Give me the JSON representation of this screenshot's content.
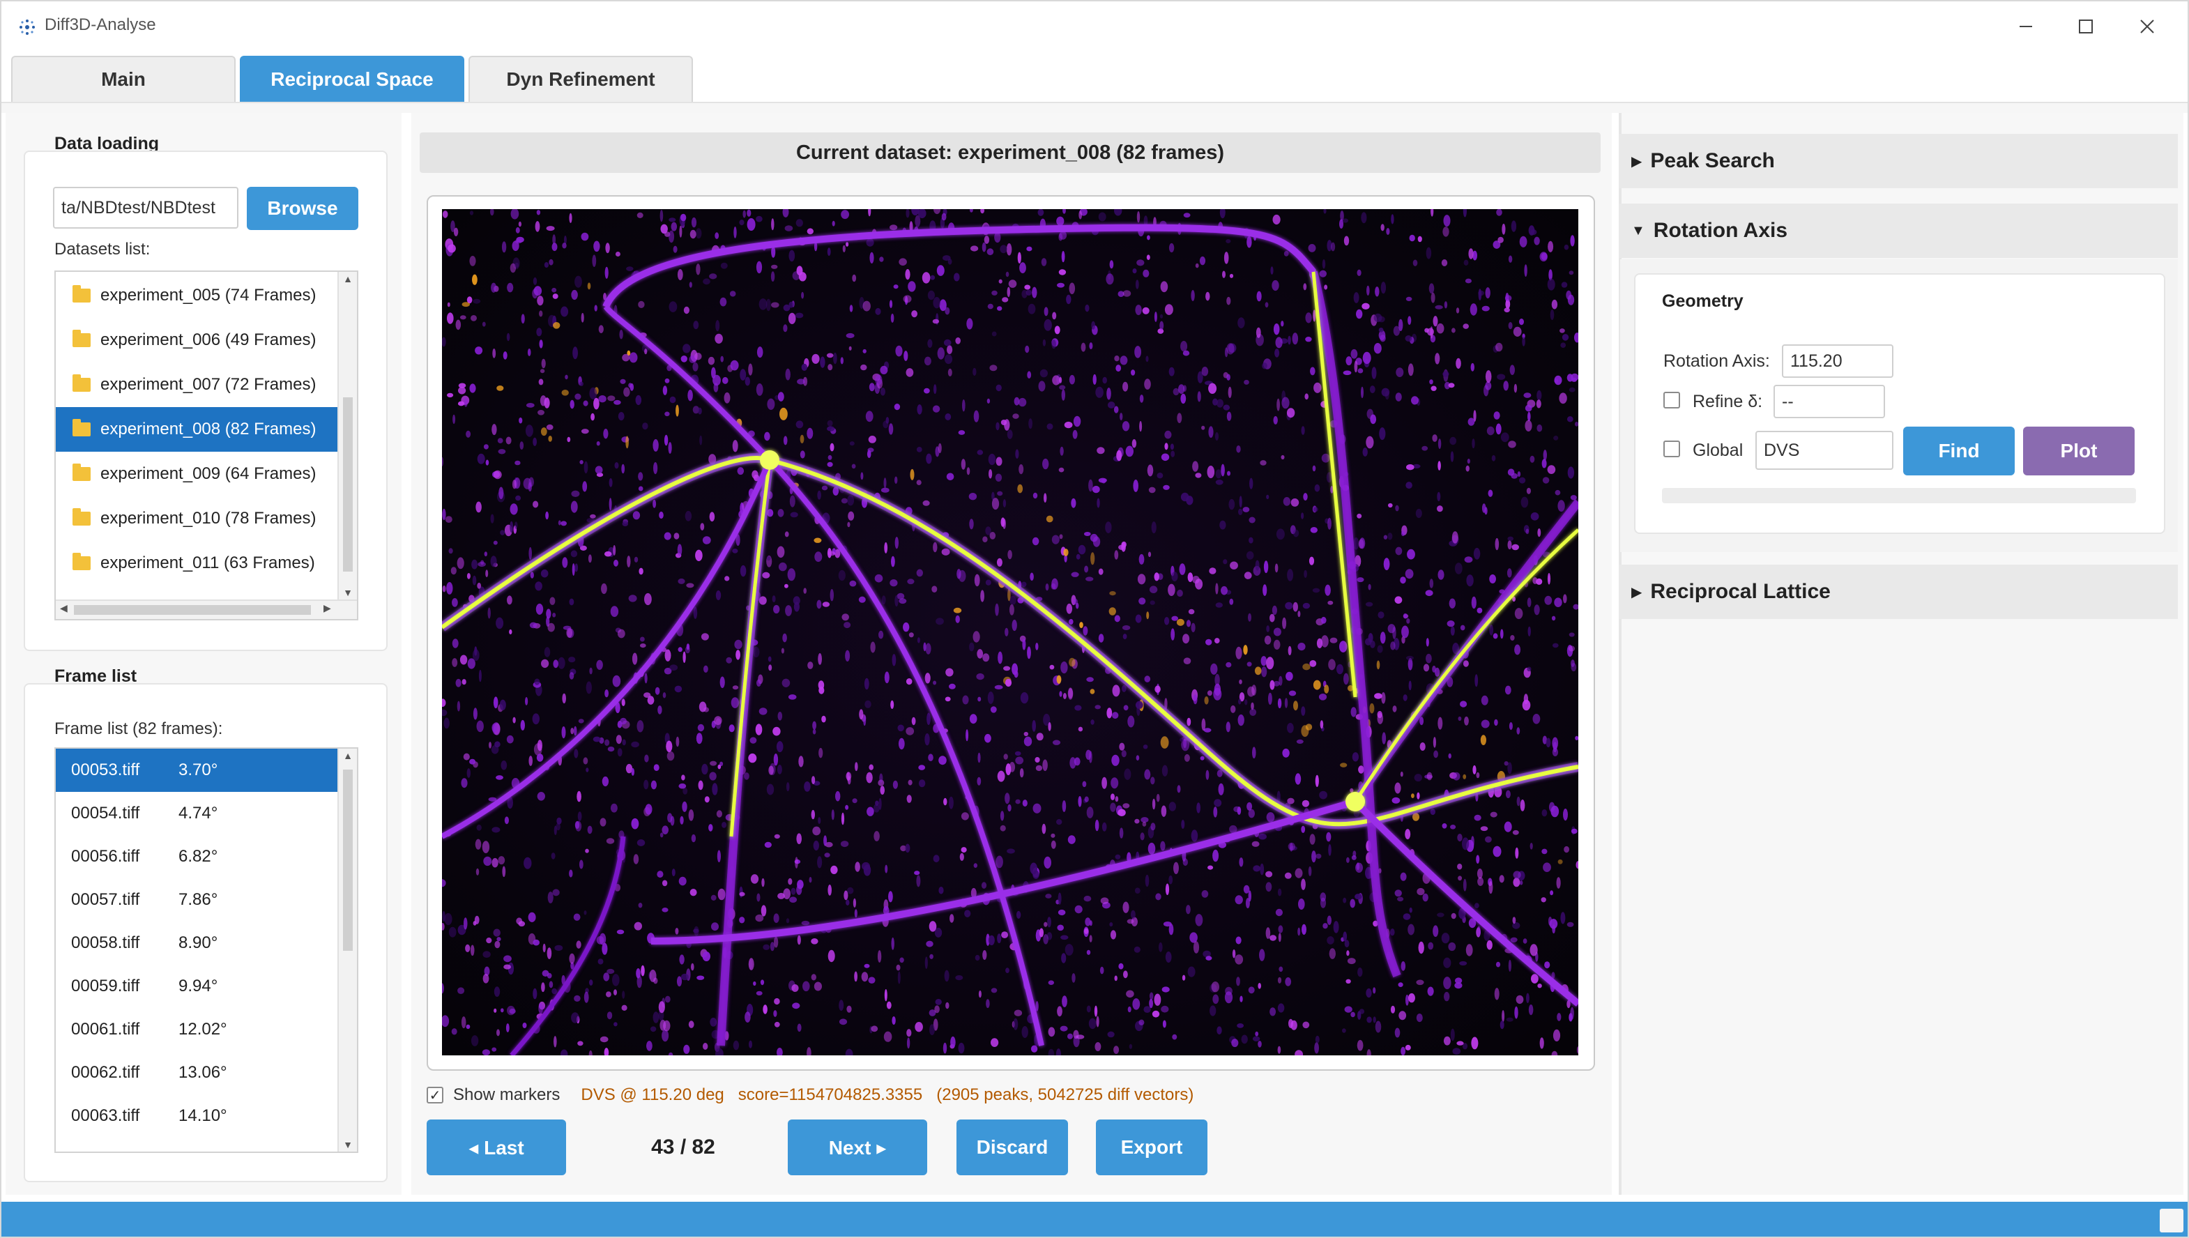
{
  "window": {
    "title": "Diff3D-Analyse",
    "icon": "app-logo-icon",
    "controls": [
      "minimize-icon",
      "maximize-icon",
      "close-icon"
    ]
  },
  "tabs": [
    {
      "label": "Main",
      "active": false
    },
    {
      "label": "Reciprocal Space",
      "active": true
    },
    {
      "label": "Dyn Refinement",
      "active": false
    }
  ],
  "left": {
    "data_loading": {
      "title": "Data loading",
      "path_value": "ta/NBDtest/NBDtest",
      "browse_label": "Browse",
      "datasets_label": "Datasets list:",
      "datasets": [
        {
          "label": "experiment_005 (74 Frames)",
          "selected": false
        },
        {
          "label": "experiment_006 (49 Frames)",
          "selected": false
        },
        {
          "label": "experiment_007 (72 Frames)",
          "selected": false
        },
        {
          "label": "experiment_008 (82 Frames)",
          "selected": true
        },
        {
          "label": "experiment_009 (64 Frames)",
          "selected": false
        },
        {
          "label": "experiment_010 (78 Frames)",
          "selected": false
        },
        {
          "label": "experiment_011 (63 Frames)",
          "selected": false
        }
      ]
    },
    "frame_list": {
      "title": "Frame list",
      "count_label": "Frame list (82 frames):",
      "frames": [
        {
          "name": "00053.tiff",
          "angle": "3.70°",
          "selected": true
        },
        {
          "name": "00054.tiff",
          "angle": "4.74°",
          "selected": false
        },
        {
          "name": "00056.tiff",
          "angle": "6.82°",
          "selected": false
        },
        {
          "name": "00057.tiff",
          "angle": "7.86°",
          "selected": false
        },
        {
          "name": "00058.tiff",
          "angle": "8.90°",
          "selected": false
        },
        {
          "name": "00059.tiff",
          "angle": "9.94°",
          "selected": false
        },
        {
          "name": "00061.tiff",
          "angle": "12.02°",
          "selected": false
        },
        {
          "name": "00062.tiff",
          "angle": "13.06°",
          "selected": false
        },
        {
          "name": "00063.tiff",
          "angle": "14.10°",
          "selected": false
        }
      ]
    }
  },
  "center": {
    "dataset_header": "Current dataset: experiment_008 (82 frames)",
    "show_markers_label": "Show markers",
    "show_markers_checked": true,
    "status_text": "DVS @ 115.20 deg   score=1154704825.3355   (2905 peaks, 5042725 diff vectors)",
    "status_color": "#b35a00",
    "buttons": {
      "last": "◂ Last",
      "next": "Next ▸",
      "discard": "Discard",
      "export": "Export"
    },
    "counter": "43 / 82",
    "image_colormap": [
      "#050308",
      "#3a0a6e",
      "#8a1fd6",
      "#c23cf0",
      "#f0a020",
      "#e8ff40"
    ]
  },
  "right": {
    "peak_search": {
      "label": "Peak Search",
      "expanded": false
    },
    "rotation_axis": {
      "label": "Rotation Axis",
      "expanded": true,
      "geometry_title": "Geometry",
      "rotation_axis_label": "Rotation Axis:",
      "rotation_axis_value": "115.20",
      "refine_label": "Refine δ:",
      "refine_value": "--",
      "refine_checked": false,
      "global_label": "Global",
      "global_checked": false,
      "global_value": "DVS",
      "find_label": "Find",
      "plot_label": "Plot"
    },
    "reciprocal_lattice": {
      "label": "Reciprocal Lattice",
      "expanded": false
    }
  },
  "colors": {
    "accent": "#3d97d8",
    "selection": "#1e73c2",
    "plot_button": "#8a6bb0"
  }
}
